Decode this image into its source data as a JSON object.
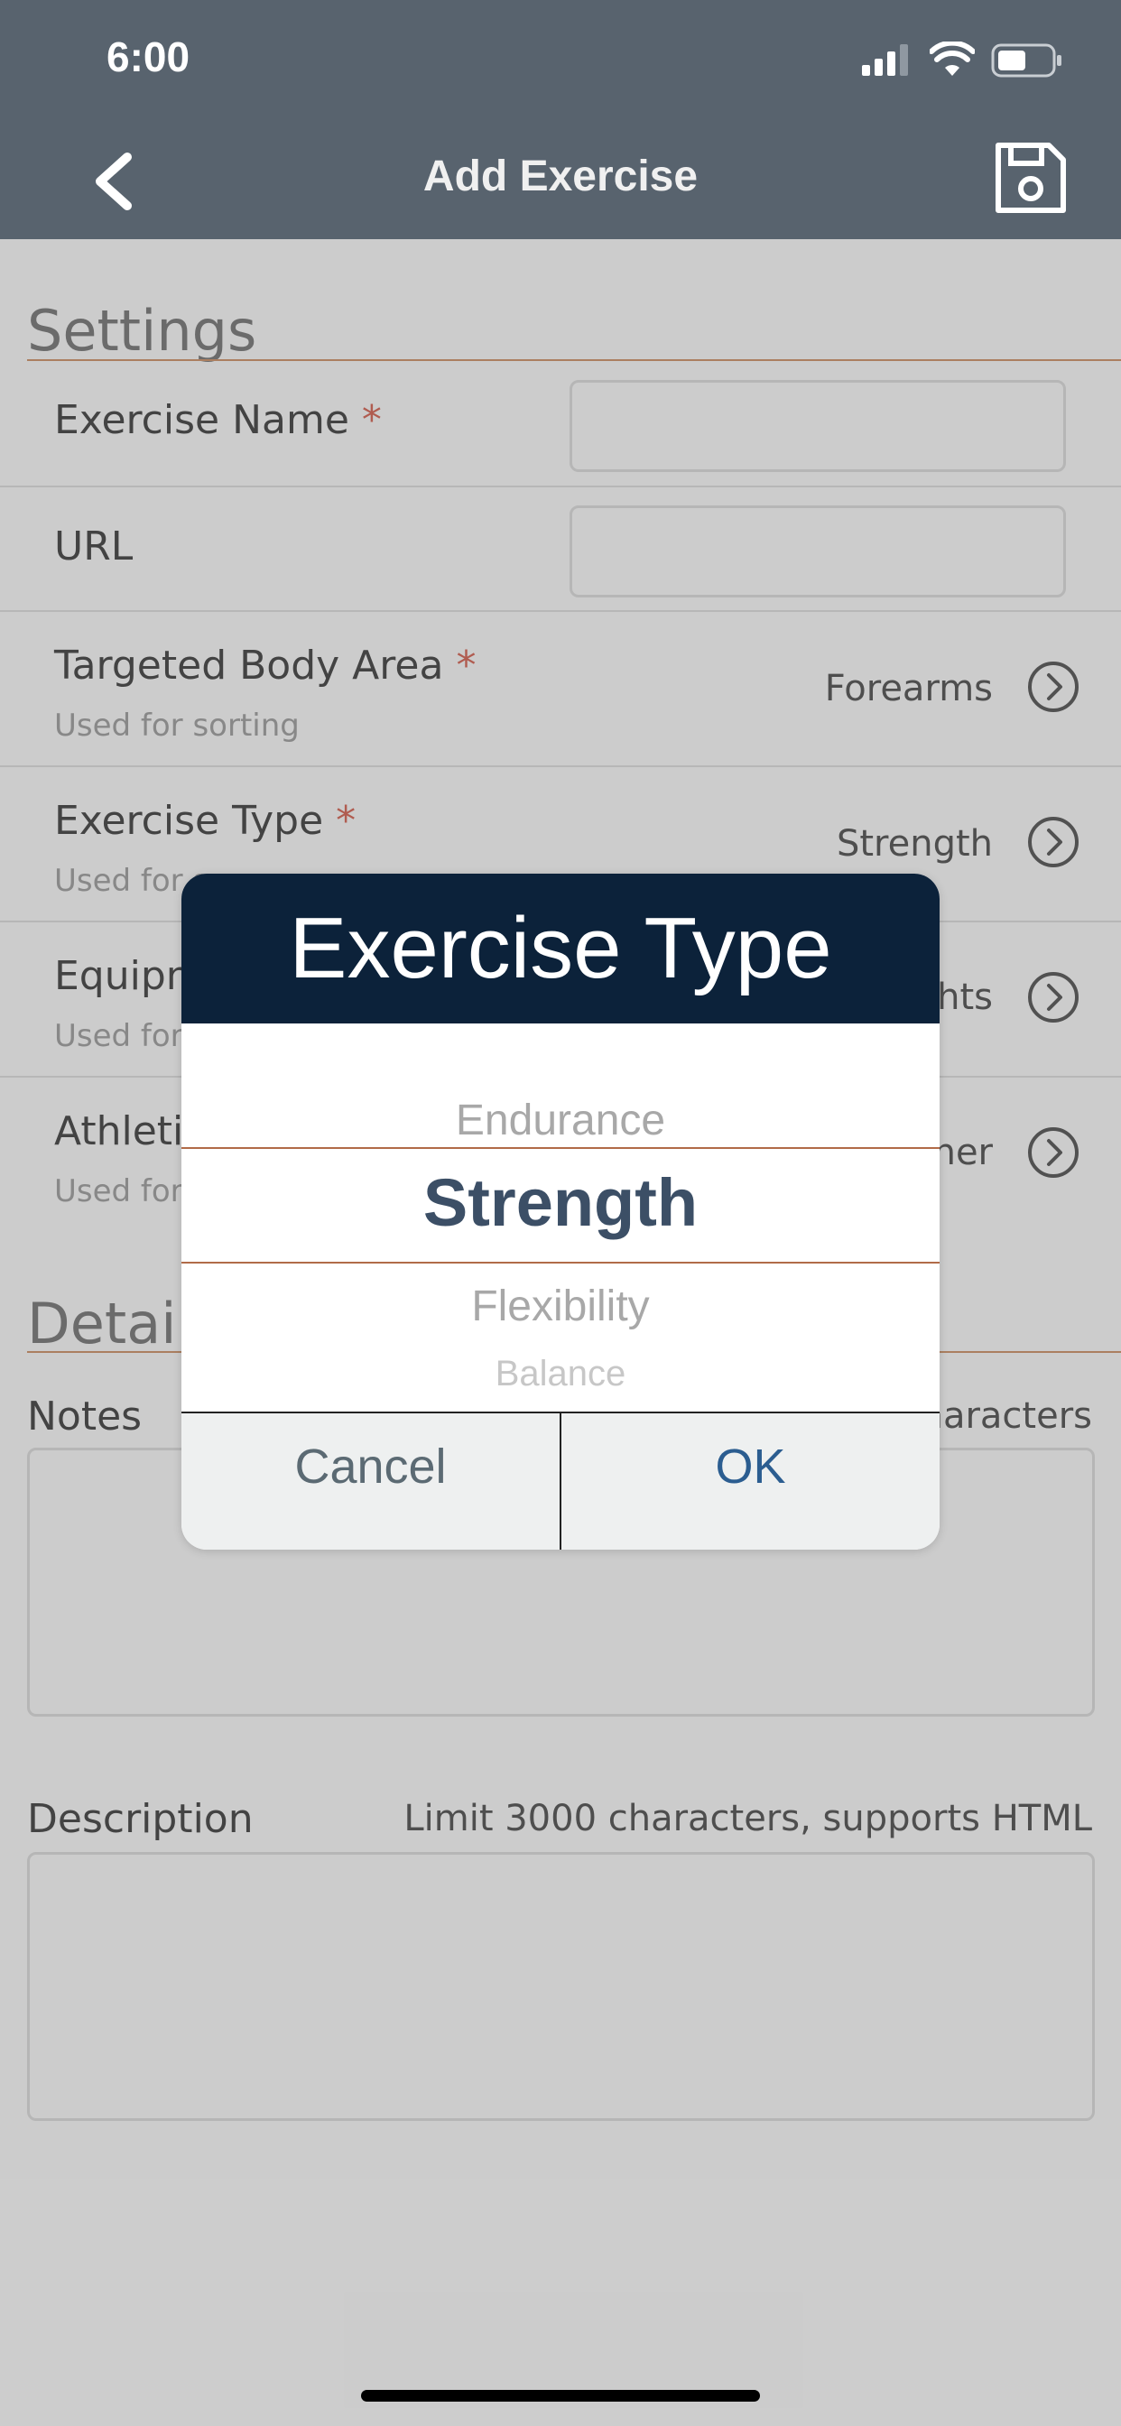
{
  "status_bar": {
    "time": "6:00"
  },
  "header": {
    "title": "Add Exercise"
  },
  "settings": {
    "title": "Settings",
    "exercise_name": {
      "label": "Exercise Name",
      "required": "*",
      "value": ""
    },
    "url": {
      "label": "URL",
      "value": ""
    },
    "body_area": {
      "label": "Targeted Body Area",
      "required": "*",
      "sub": "Used for sorting",
      "value": "Forearms"
    },
    "exercise_type": {
      "label": "Exercise Type",
      "required": "*",
      "sub": "Used for s",
      "value": "Strength"
    },
    "equipment": {
      "label": "Equipn",
      "sub": "Used for",
      "value": "hts"
    },
    "athletic": {
      "label": "Athleti",
      "sub": "Used for",
      "value": "ner"
    }
  },
  "details": {
    "title": "Detail",
    "notes": {
      "label": "Notes",
      "limit": "naracters"
    },
    "description": {
      "label": "Description",
      "limit": "Limit 3000 characters, supports HTML"
    }
  },
  "dialog": {
    "title": "Exercise Type",
    "options": [
      "Endurance",
      "Strength",
      "Flexibility",
      "Balance"
    ],
    "selected": "Strength",
    "cancel": "Cancel",
    "ok": "OK"
  },
  "colors": {
    "header_bg": "#58636e",
    "dialog_header_bg": "#0c223a",
    "required": "#b65b4e",
    "accent_rule": "#b0815f"
  }
}
